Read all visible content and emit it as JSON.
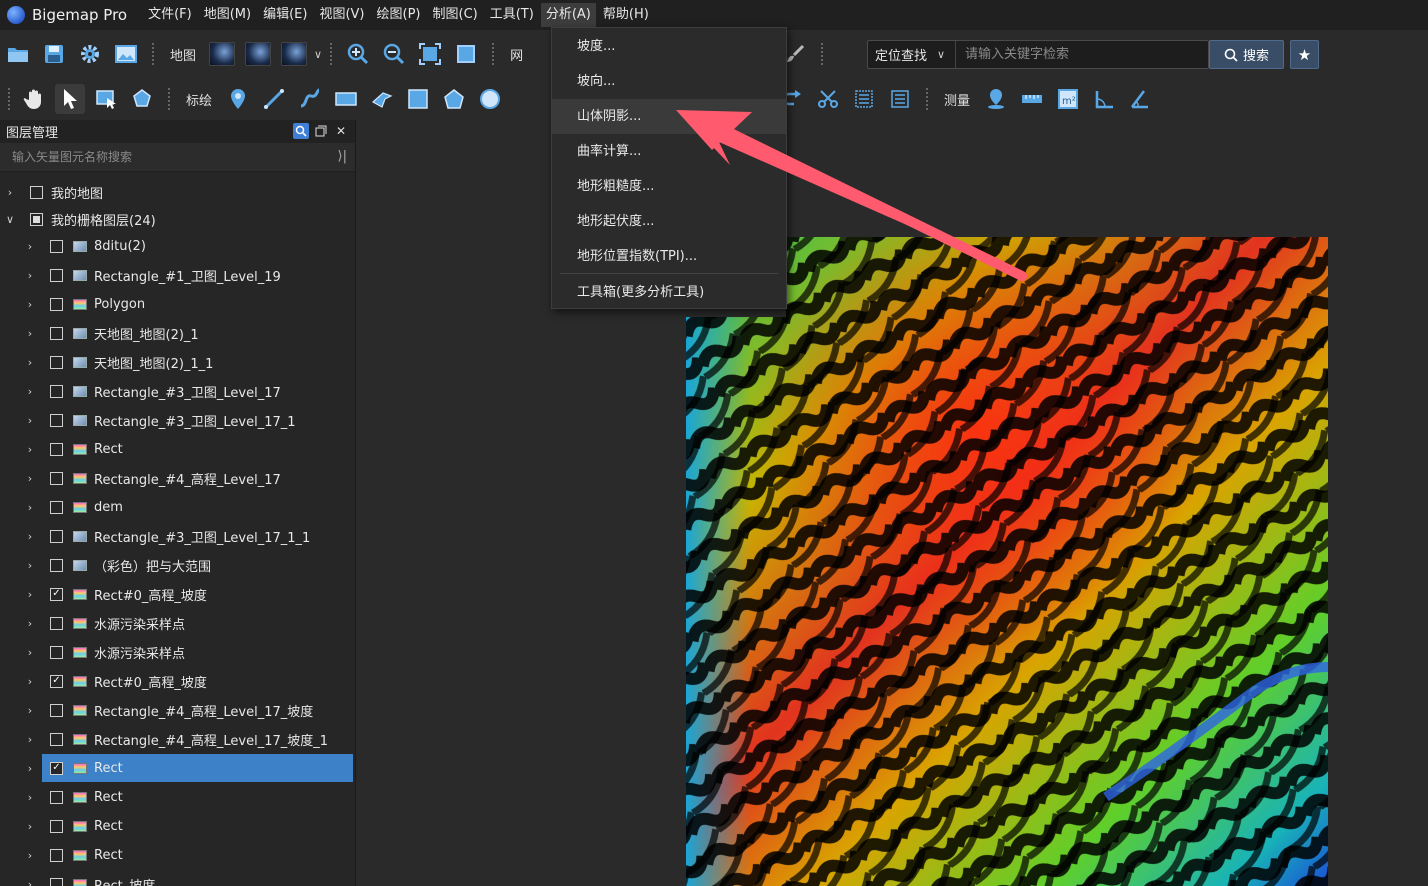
{
  "app": {
    "title": "Bigemap Pro"
  },
  "menu": [
    {
      "label": "文件(F)"
    },
    {
      "label": "地图(M)"
    },
    {
      "label": "编辑(E)"
    },
    {
      "label": "视图(V)"
    },
    {
      "label": "绘图(P)"
    },
    {
      "label": "制图(C)"
    },
    {
      "label": "工具(T)"
    },
    {
      "label": "分析(A)"
    },
    {
      "label": "帮助(H)"
    }
  ],
  "toolbar1": {
    "map_label": "地图",
    "net_label": "网"
  },
  "toolbar2": {
    "mark_label": "标绘",
    "measure_label": "测量"
  },
  "search": {
    "locate_label": "定位查找",
    "placeholder": "请输入关键字检索",
    "button_label": "搜索"
  },
  "analysis_menu": {
    "items": [
      {
        "label": "坡度..."
      },
      {
        "label": "坡向..."
      },
      {
        "label": "山体阴影..."
      },
      {
        "label": "曲率计算..."
      },
      {
        "label": "地形粗糙度..."
      },
      {
        "label": "地形起伏度..."
      },
      {
        "label": "地形位置指数(TPI)..."
      },
      {
        "label": "工具箱(更多分析工具)"
      }
    ]
  },
  "layer_panel": {
    "title": "图层管理",
    "search_placeholder": "输入矢量图元名称搜索",
    "rows": [
      {
        "label": "我的地图",
        "checked": false,
        "icon": "none"
      },
      {
        "label": "我的栅格图层(24)",
        "checked": "partial",
        "icon": "none"
      },
      {
        "label": "8ditu(2)",
        "checked": false,
        "icon": "image"
      },
      {
        "label": "Rectangle_#1_卫图_Level_19",
        "checked": false,
        "icon": "image"
      },
      {
        "label": "Polygon",
        "checked": false,
        "icon": "rainbow"
      },
      {
        "label": "天地图_地图(2)_1",
        "checked": false,
        "icon": "image"
      },
      {
        "label": "天地图_地图(2)_1_1",
        "checked": false,
        "icon": "image"
      },
      {
        "label": "Rectangle_#3_卫图_Level_17",
        "checked": false,
        "icon": "image"
      },
      {
        "label": "Rectangle_#3_卫图_Level_17_1",
        "checked": false,
        "icon": "image"
      },
      {
        "label": "Rect",
        "checked": false,
        "icon": "rainbow"
      },
      {
        "label": "Rectangle_#4_高程_Level_17",
        "checked": false,
        "icon": "rainbow"
      },
      {
        "label": "dem",
        "checked": false,
        "icon": "rainbow"
      },
      {
        "label": "Rectangle_#3_卫图_Level_17_1_1",
        "checked": false,
        "icon": "image"
      },
      {
        "label": "（彩色）把与大范围",
        "checked": false,
        "icon": "image"
      },
      {
        "label": "Rect#0_高程_坡度",
        "checked": true,
        "icon": "rainbow"
      },
      {
        "label": "水源污染采样点",
        "checked": false,
        "icon": "rainbow"
      },
      {
        "label": "水源污染采样点",
        "checked": false,
        "icon": "rainbow"
      },
      {
        "label": "Rect#0_高程_坡度",
        "checked": true,
        "icon": "rainbow"
      },
      {
        "label": "Rectangle_#4_高程_Level_17_坡度",
        "checked": false,
        "icon": "rainbow"
      },
      {
        "label": "Rectangle_#4_高程_Level_17_坡度_1",
        "checked": false,
        "icon": "rainbow"
      },
      {
        "label": "Rect",
        "checked": true,
        "icon": "rainbow",
        "selected": true
      },
      {
        "label": "Rect",
        "checked": false,
        "icon": "rainbow"
      },
      {
        "label": "Rect",
        "checked": false,
        "icon": "rainbow"
      },
      {
        "label": "Rect",
        "checked": false,
        "icon": "rainbow"
      },
      {
        "label": "Rect_坡度",
        "checked": false,
        "icon": "rainbow"
      }
    ]
  },
  "colors": {
    "accent": "#3d82c9",
    "arrow": "#ff5a6e"
  }
}
